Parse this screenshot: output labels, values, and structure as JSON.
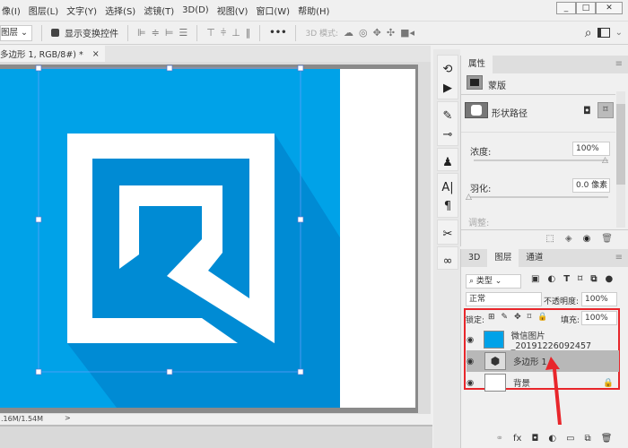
{
  "menu": [
    "像(I)",
    "图层(L)",
    "文字(Y)",
    "选择(S)",
    "滤镜(T)",
    "3D(D)",
    "视图(V)",
    "窗口(W)",
    "帮助(H)"
  ],
  "window_buttons": {
    "minimize": "_",
    "maximize": "□",
    "close": "✕"
  },
  "options": {
    "auto_select": "图层",
    "show_transform": "显示变换控件",
    "more": "•••",
    "mode3d": "3D 模式:"
  },
  "doc_tab": {
    "title": "多边形 1, RGB/8#) *",
    "close": "×"
  },
  "status": {
    "doc_size": ".16M/1.54M",
    "arrow": ">"
  },
  "colors": {
    "canvas_blue": "#00a2e8",
    "shadow_blue": "#008bd4",
    "highlight_red": "#e8262b"
  },
  "properties": {
    "tab": "属性",
    "mask_label": "蒙版",
    "shape_path": "形状路径",
    "density_label": "浓度:",
    "density_value": "100%",
    "feather_label": "羽化:",
    "feather_value": "0.0 像素",
    "adjust_label": "调整:",
    "density": 100,
    "feather": 0
  },
  "layers": {
    "tabs": [
      "3D",
      "图层",
      "通道"
    ],
    "filter_kind": "类型",
    "blend_mode": "正常",
    "opacity_label": "不透明度:",
    "opacity_value": "100%",
    "lock_label": "锁定:",
    "fill_label": "填充:",
    "fill_value": "100%",
    "items": [
      {
        "name": "微信图片_20191226092457"
      },
      {
        "name": "多边形 1",
        "selected": true
      },
      {
        "name": "背景",
        "locked": true
      }
    ]
  }
}
